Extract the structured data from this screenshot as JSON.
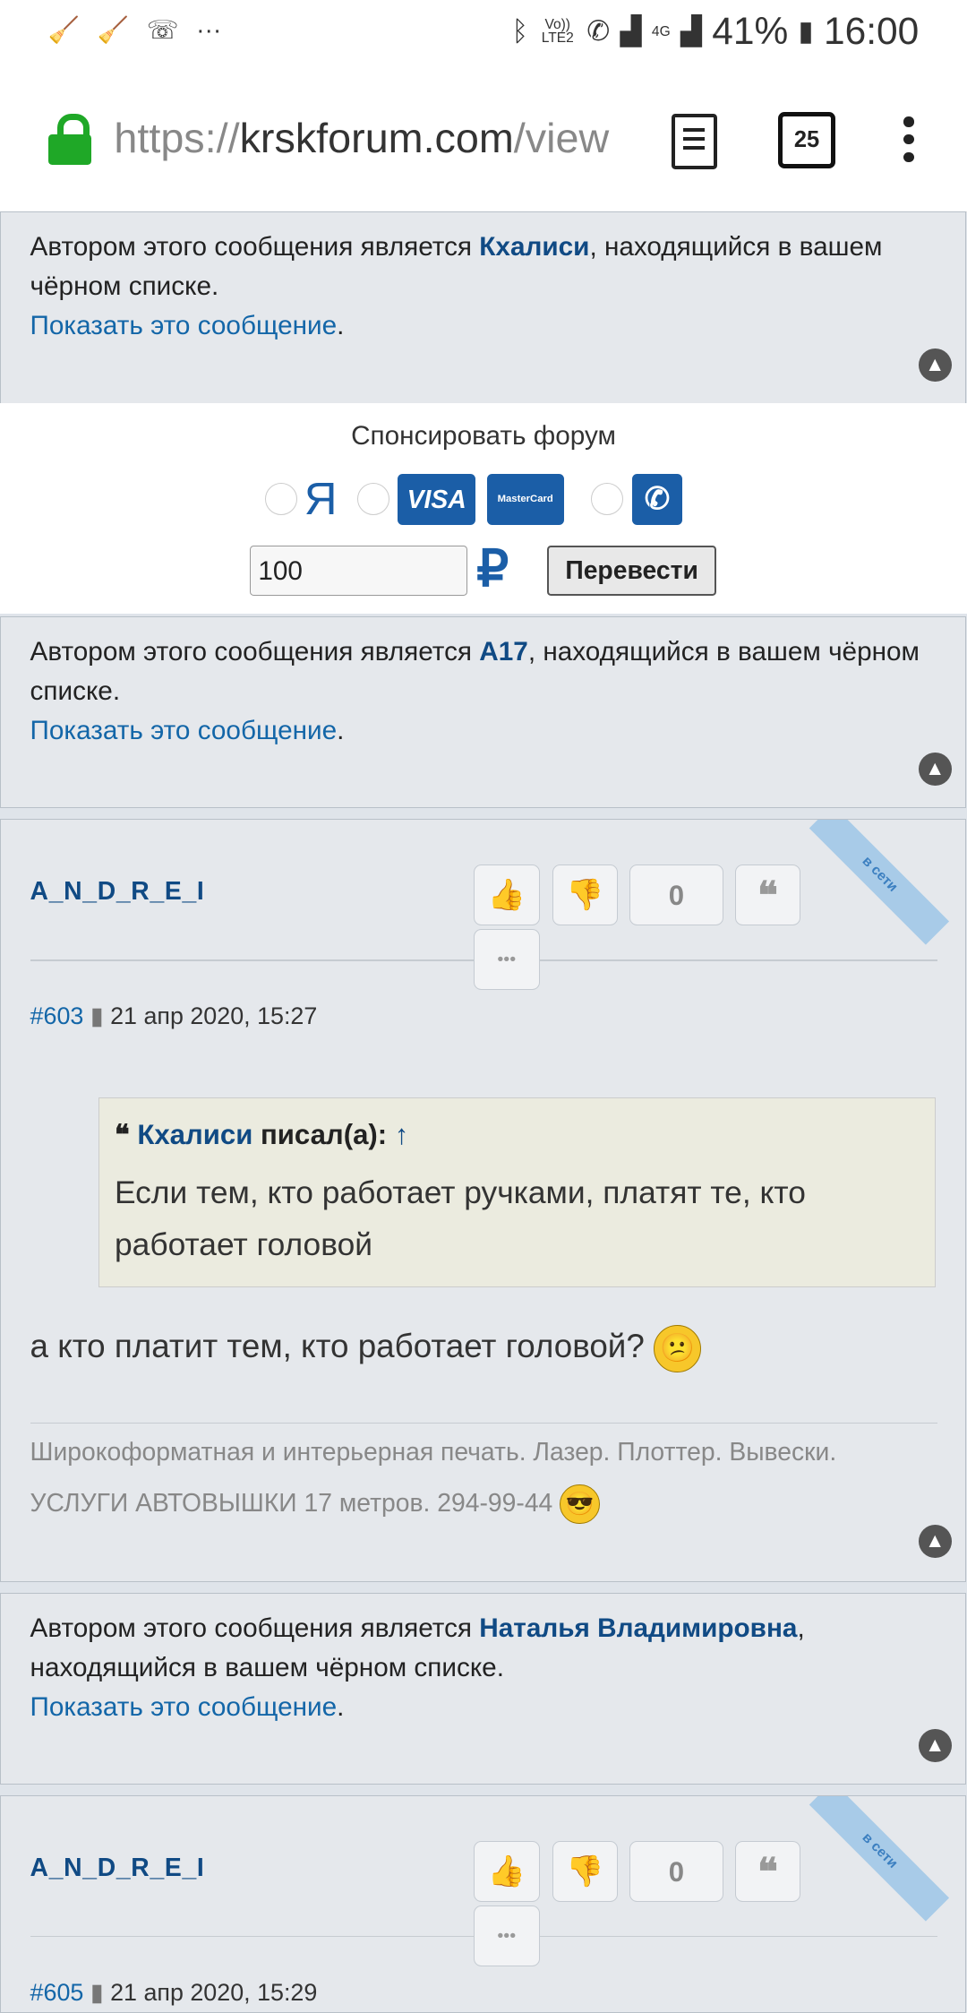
{
  "statusbar": {
    "left_icons": [
      "broom-icon",
      "broom-icon",
      "missed-call-icon",
      "more-dots-icon"
    ],
    "volte": "Vo)) LTE2",
    "net": "4G",
    "battery": "41%",
    "time": "16:00"
  },
  "browser": {
    "url_scheme": "https://",
    "url_host": "krskforum.com",
    "url_path": "/view",
    "tab_count": "25"
  },
  "blocked1": {
    "prefix": "Автором этого сообщения является ",
    "user": "Кхалиси",
    "suffix": ", находящийся в вашем чёрном списке.",
    "show": "Показать это сообщение",
    "dot": "."
  },
  "sponsor": {
    "title": "Спонсировать форум",
    "yandex": "Я",
    "visa": "VISA",
    "mastercard": "MasterCard",
    "amount": "100",
    "currency": "₽",
    "send": "Перевести"
  },
  "blocked2": {
    "prefix": "Автором этого сообщения является ",
    "user": "A17",
    "suffix": ", находящийся в вашем чёрном списке.",
    "show": "Показать это сообщение",
    "dot": "."
  },
  "post1": {
    "author": "A_N_D_R_E_I",
    "votes": "0",
    "more": "•••",
    "online": "в сети",
    "number": "#603",
    "date": "21 апр 2020, 15:27",
    "quote_user": "Кхалиси",
    "quote_wrote": " писал(а): ",
    "quote_arrow": "↑",
    "quote_text": "Если тем, кто работает ручками, платят те, кто работает головой",
    "body": "а кто платит тем, кто работает головой?",
    "signature": "Широкоформатная и интерьерная печать. Лазер. Плоттер. Вывески. УСЛУГИ АВТОВЫШКИ 17 метров. 294-99-44"
  },
  "blocked3": {
    "prefix": "Автором этого сообщения является ",
    "user": "Наталья Владимировна",
    "suffix": ", находящийся в вашем чёрном списке.",
    "show": "Показать это сообщение",
    "dot": "."
  },
  "post2": {
    "author": "A_N_D_R_E_I",
    "votes": "0",
    "more": "•••",
    "online": "в сети",
    "number": "#605",
    "date": "21 апр 2020, 15:29"
  },
  "colors": {
    "link": "#1366a8",
    "username": "#104a84",
    "lock": "#1fa827",
    "pay_blue": "#1b5ea7"
  }
}
